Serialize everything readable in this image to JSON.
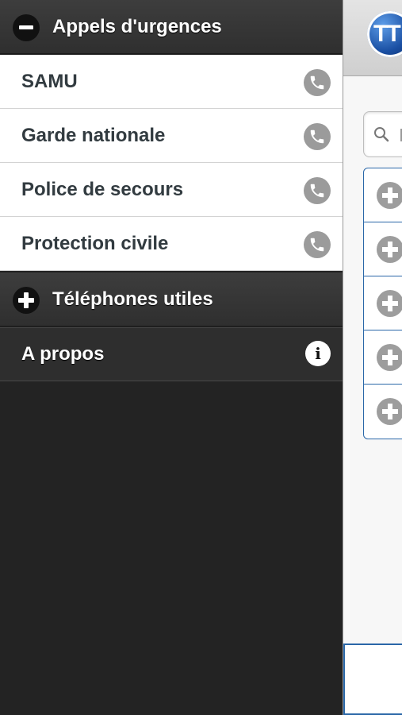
{
  "sidebar": {
    "emergency_header": {
      "label": "Appels d'urgences",
      "expanded": true,
      "icon": "minus-icon"
    },
    "emergency_items": [
      {
        "label": "SAMU",
        "icon": "phone-icon"
      },
      {
        "label": "Garde nationale",
        "icon": "phone-icon"
      },
      {
        "label": "Police de secours",
        "icon": "phone-icon"
      },
      {
        "label": "Protection civile",
        "icon": "phone-icon"
      }
    ],
    "useful_header": {
      "label": "Téléphones utiles",
      "expanded": false,
      "icon": "plus-icon"
    },
    "about": {
      "label": "A propos",
      "icon": "info-icon",
      "icon_glyph": "i"
    }
  },
  "main": {
    "logo_text": "TT",
    "search_icon": "search-icon",
    "list_rows": 5,
    "row_icon": "add-circle-icon"
  },
  "colors": {
    "panel_bg": "#232323",
    "accent_blue": "#2a67a8",
    "icon_gray": "#9b9b9b"
  }
}
